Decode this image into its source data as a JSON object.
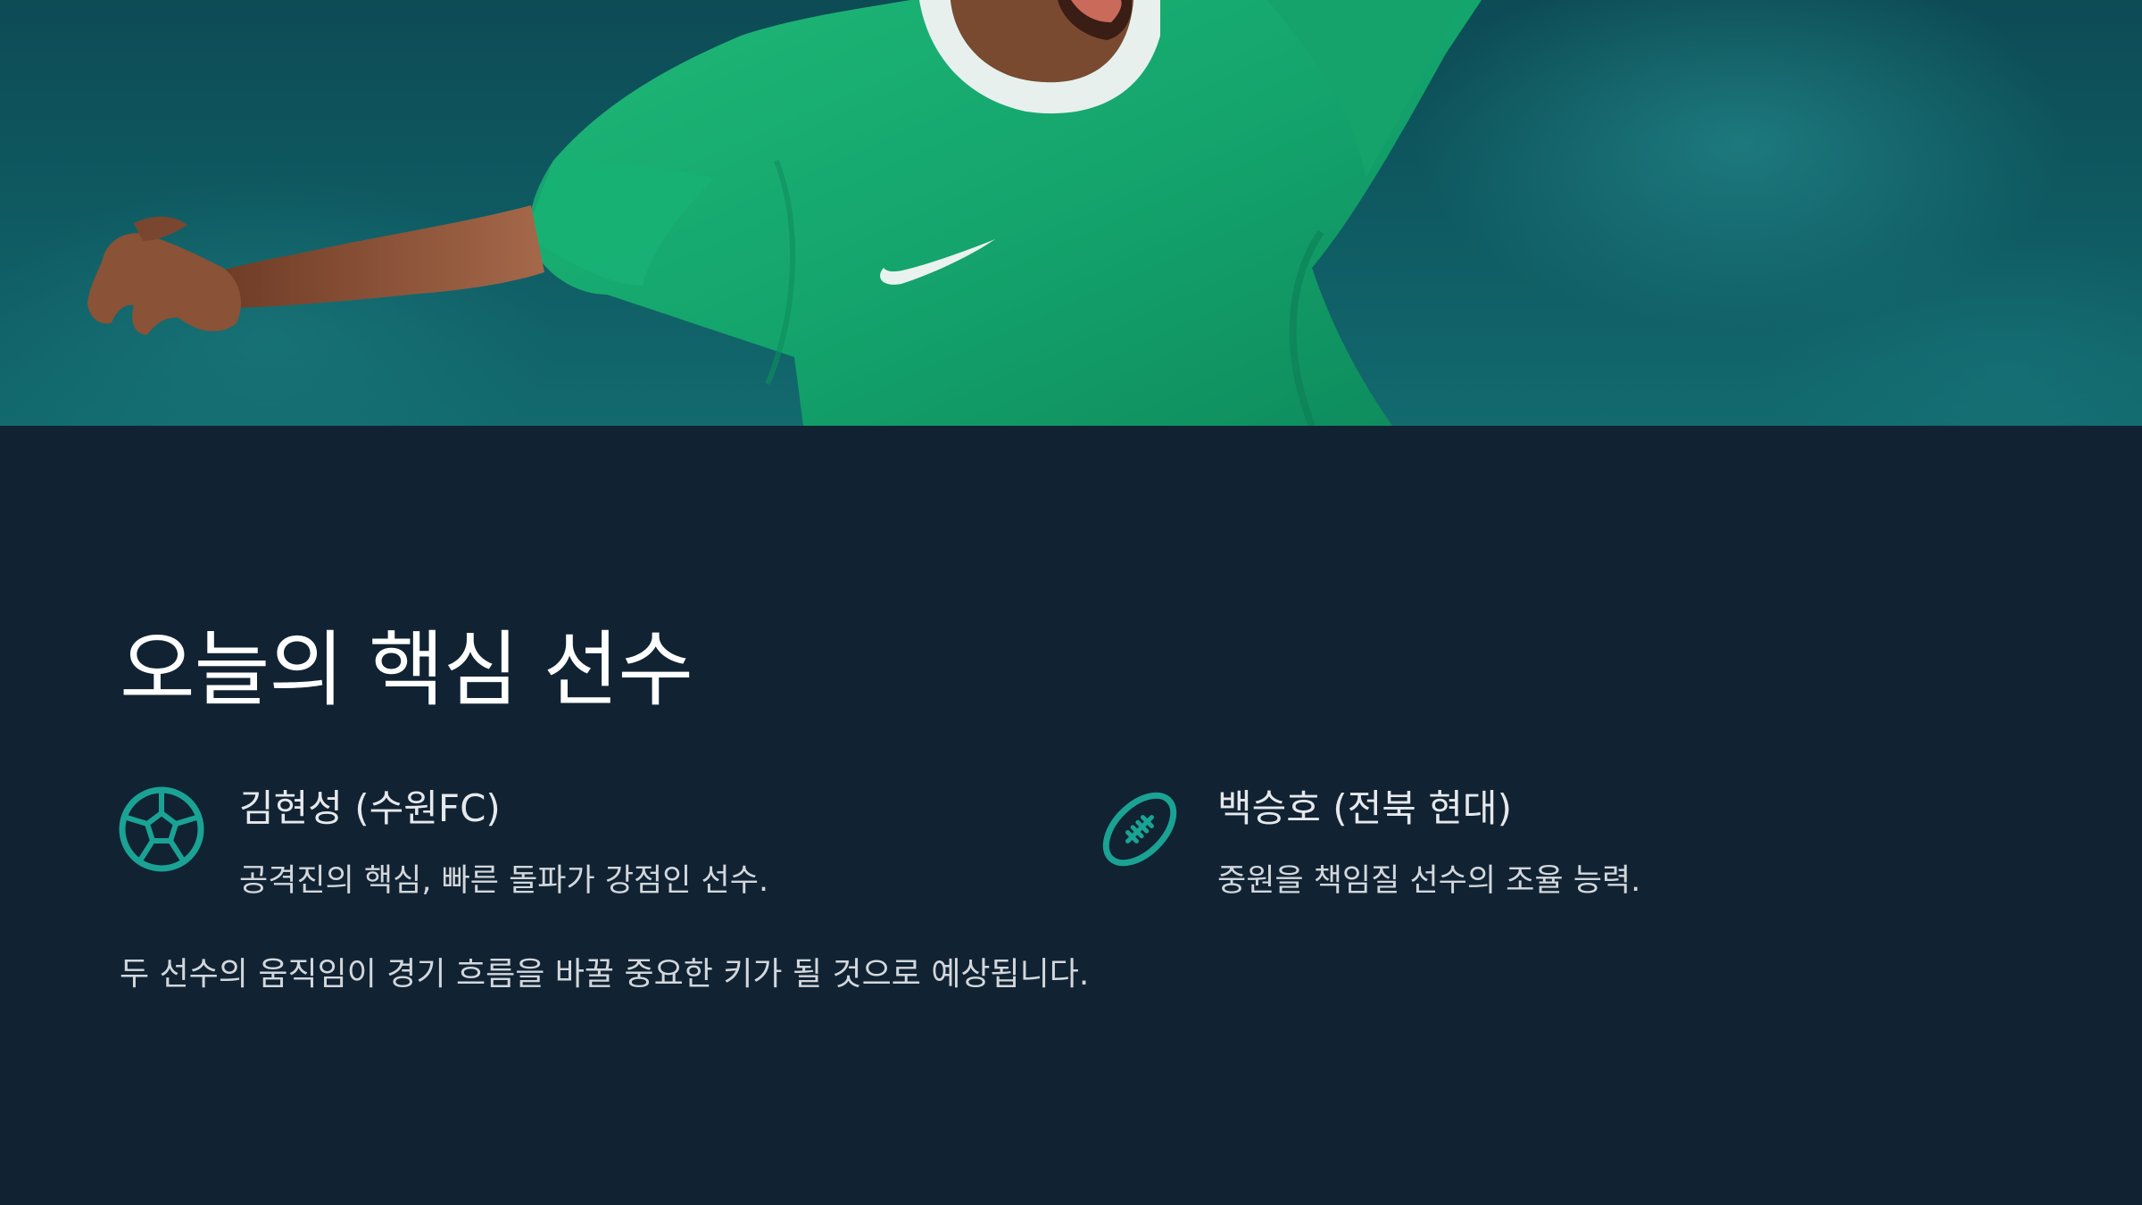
{
  "hero": {
    "image": "soccer-player-in-green-jersey"
  },
  "colors": {
    "background": "#112333",
    "accent": "#1aa394",
    "jersey": "#17a96f"
  },
  "title": "오늘의 핵심 선수",
  "players": [
    {
      "icon": "soccer-ball-icon",
      "name": "김현성 (수원FC)",
      "description": "공격진의 핵심, 빠른 돌파가 강점인 선수."
    },
    {
      "icon": "football-icon",
      "name": "백승호 (전북 현대)",
      "description": "중원을 책임질 선수의 조율 능력."
    }
  ],
  "summary": "두 선수의 움직임이 경기 흐름을 바꿀 중요한 키가 될 것으로 예상됩니다."
}
